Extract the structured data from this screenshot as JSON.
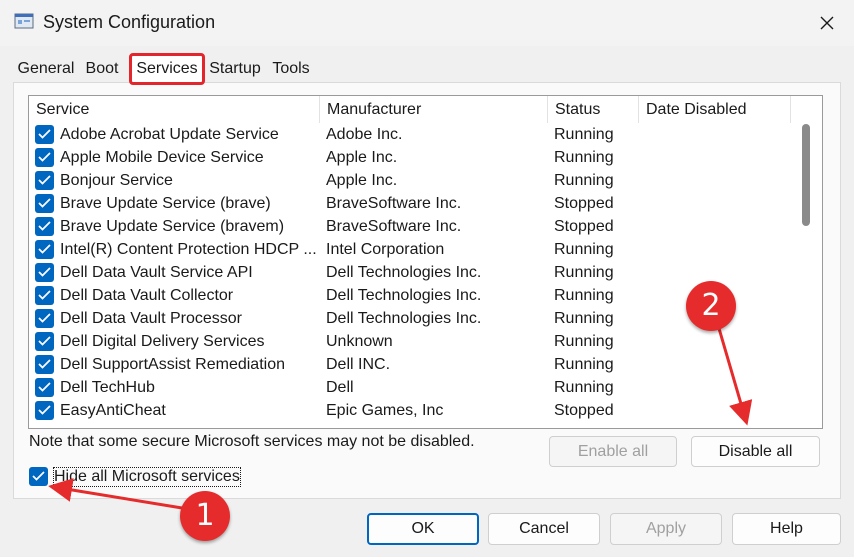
{
  "window": {
    "title": "System Configuration"
  },
  "tabs": [
    {
      "label": "General"
    },
    {
      "label": "Boot"
    },
    {
      "label": "Services"
    },
    {
      "label": "Startup"
    },
    {
      "label": "Tools"
    }
  ],
  "services": {
    "columns": [
      "Service",
      "Manufacturer",
      "Status",
      "Date Disabled"
    ],
    "rows": [
      {
        "name": "Adobe Acrobat Update Service",
        "manufacturer": "Adobe Inc.",
        "status": "Running",
        "date": "",
        "checked": true
      },
      {
        "name": "Apple Mobile Device Service",
        "manufacturer": "Apple Inc.",
        "status": "Running",
        "date": "",
        "checked": true
      },
      {
        "name": "Bonjour Service",
        "manufacturer": "Apple Inc.",
        "status": "Running",
        "date": "",
        "checked": true
      },
      {
        "name": "Brave Update Service (brave)",
        "manufacturer": "BraveSoftware Inc.",
        "status": "Stopped",
        "date": "",
        "checked": true
      },
      {
        "name": "Brave Update Service (bravem)",
        "manufacturer": "BraveSoftware Inc.",
        "status": "Stopped",
        "date": "",
        "checked": true
      },
      {
        "name": "Intel(R) Content Protection HDCP ...",
        "manufacturer": "Intel Corporation",
        "status": "Running",
        "date": "",
        "checked": true
      },
      {
        "name": "Dell Data Vault Service API",
        "manufacturer": "Dell Technologies Inc.",
        "status": "Running",
        "date": "",
        "checked": true
      },
      {
        "name": "Dell Data Vault Collector",
        "manufacturer": "Dell Technologies Inc.",
        "status": "Running",
        "date": "",
        "checked": true
      },
      {
        "name": "Dell Data Vault Processor",
        "manufacturer": "Dell Technologies Inc.",
        "status": "Running",
        "date": "",
        "checked": true
      },
      {
        "name": "Dell Digital Delivery Services",
        "manufacturer": "Unknown",
        "status": "Running",
        "date": "",
        "checked": true
      },
      {
        "name": "Dell SupportAssist Remediation",
        "manufacturer": "Dell INC.",
        "status": "Running",
        "date": "",
        "checked": true
      },
      {
        "name": "Dell TechHub",
        "manufacturer": "Dell",
        "status": "Running",
        "date": "",
        "checked": true
      },
      {
        "name": "EasyAntiCheat",
        "manufacturer": "Epic Games, Inc",
        "status": "Stopped",
        "date": "",
        "checked": true
      }
    ]
  },
  "note": "Note that some secure Microsoft services may not be disabled.",
  "buttons": {
    "enable_all": "Enable all",
    "disable_all": "Disable all",
    "ok": "OK",
    "cancel": "Cancel",
    "apply": "Apply",
    "help": "Help"
  },
  "hide_microsoft": {
    "label": "Hide all Microsoft services",
    "checked": true
  },
  "annotations": [
    {
      "label": "1"
    },
    {
      "label": "2"
    }
  ],
  "colors": {
    "accent": "#0067c0",
    "highlight": "#e2262c"
  },
  "icons": {
    "app": "system-config-icon",
    "close": "close-icon",
    "check": "checkmark-icon"
  }
}
